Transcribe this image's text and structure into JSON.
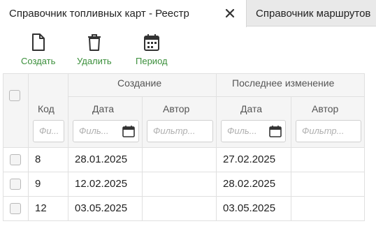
{
  "tabs": [
    {
      "label": "Справочник топливных карт - Реестр",
      "active": true
    },
    {
      "label": "Справочник маршрутов",
      "active": false
    }
  ],
  "toolbar": {
    "create_label": "Создать",
    "delete_label": "Удалить",
    "period_label": "Период",
    "accent": "#3b8f3b"
  },
  "grid": {
    "headers": {
      "code": "Код",
      "created_group": "Создание",
      "changed_group": "Последнее изменение",
      "created_date": "Дата",
      "created_author": "Автор",
      "changed_date": "Дата",
      "changed_author": "Автор"
    },
    "filters": {
      "code": "Фи...",
      "created_date": "Филь...",
      "created_author": "Фильтр...",
      "changed_date": "Филь...",
      "changed_author": "Фильтр..."
    },
    "rows": [
      {
        "code": "8",
        "created_date": "28.01.2025",
        "created_author": "",
        "changed_date": "27.02.2025",
        "changed_author": ""
      },
      {
        "code": "9",
        "created_date": "12.02.2025",
        "created_author": "",
        "changed_date": "28.02.2025",
        "changed_author": ""
      },
      {
        "code": "12",
        "created_date": "03.05.2025",
        "created_author": "",
        "changed_date": "03.05.2025",
        "changed_author": ""
      }
    ]
  }
}
